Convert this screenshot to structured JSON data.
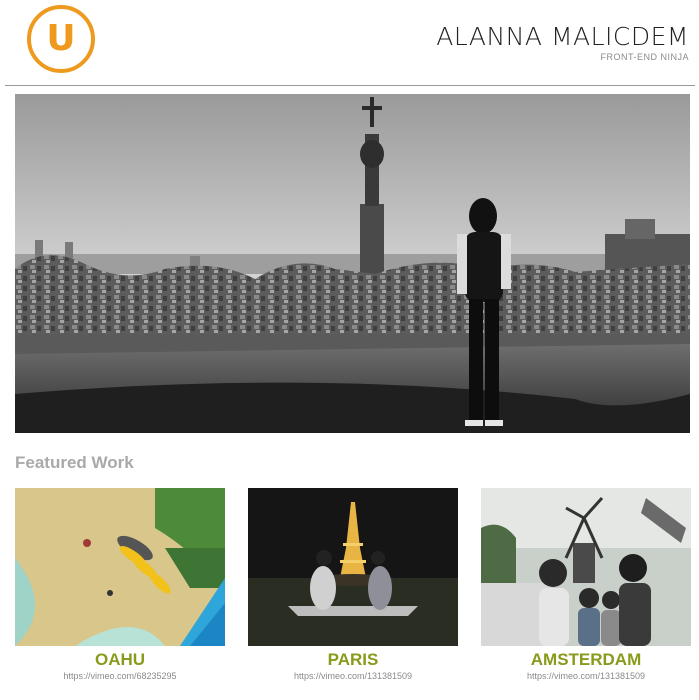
{
  "header": {
    "logo_letter": "U",
    "name": "ALANNA MALICDEM",
    "tagline": "FRONT-END NINJA"
  },
  "hero": {
    "scene": "black-and-white photo of a woman overlooking a city from a mosaic terrace"
  },
  "featured": {
    "title": "Featured Work",
    "items": [
      {
        "title": "OAHU",
        "url": "https://vimeo.com/68235295"
      },
      {
        "title": "PARIS",
        "url": "https://vimeo.com/131381509"
      },
      {
        "title": "AMSTERDAM",
        "url": "https://vimeo.com/131381509"
      }
    ]
  },
  "colors": {
    "accent_orange": "#ee9a1f",
    "title_olive": "#8a9a1a",
    "muted_gray": "#a9a9a9"
  }
}
